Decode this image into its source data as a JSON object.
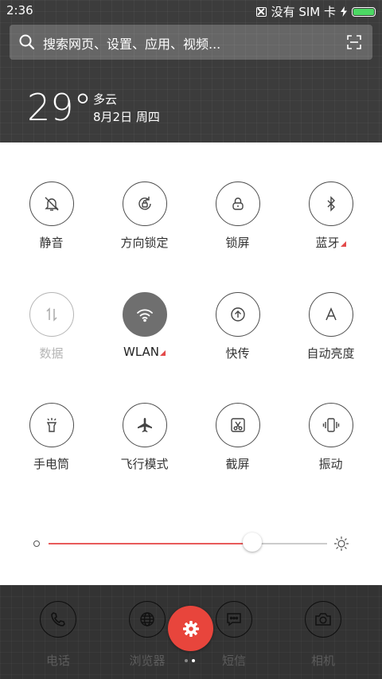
{
  "status": {
    "time": "2:36",
    "sim": "没有 SIM 卡",
    "battery_level": 1.0
  },
  "search": {
    "placeholder": "搜索网页、设置、应用、视频..."
  },
  "weather": {
    "temp": "29°",
    "condition": "多云",
    "date": "8月2日 周四"
  },
  "toggles": [
    {
      "label": "静音",
      "icon": "bell-off-icon",
      "state": "off"
    },
    {
      "label": "方向锁定",
      "icon": "rotation-lock-icon",
      "state": "off"
    },
    {
      "label": "锁屏",
      "icon": "lock-icon",
      "state": "off"
    },
    {
      "label": "蓝牙",
      "icon": "bluetooth-icon",
      "state": "off"
    },
    {
      "label": "数据",
      "icon": "data-arrows-icon",
      "state": "disabled"
    },
    {
      "label": "WLAN",
      "icon": "wifi-icon",
      "state": "on"
    },
    {
      "label": "快传",
      "icon": "upload-icon",
      "state": "off"
    },
    {
      "label": "自动亮度",
      "icon": "auto-brightness-icon",
      "state": "off"
    },
    {
      "label": "手电筒",
      "icon": "flashlight-icon",
      "state": "off"
    },
    {
      "label": "飞行模式",
      "icon": "airplane-icon",
      "state": "off"
    },
    {
      "label": "截屏",
      "icon": "screenshot-icon",
      "state": "off"
    },
    {
      "label": "振动",
      "icon": "vibrate-icon",
      "state": "off"
    }
  ],
  "brightness": {
    "level": 0.73
  },
  "dock": {
    "apps": [
      {
        "label": "电话",
        "icon": "phone-icon"
      },
      {
        "label": "浏览器",
        "icon": "globe-icon"
      },
      {
        "label": "短信",
        "icon": "message-icon"
      },
      {
        "label": "相机",
        "icon": "camera-icon"
      }
    ],
    "settings_icon": "gear-icon",
    "page_count": 2,
    "current_page": 2
  },
  "colors": {
    "accent": "#e8453c",
    "wifi_active": "#6f6f6f",
    "battery": "#4cd964"
  }
}
